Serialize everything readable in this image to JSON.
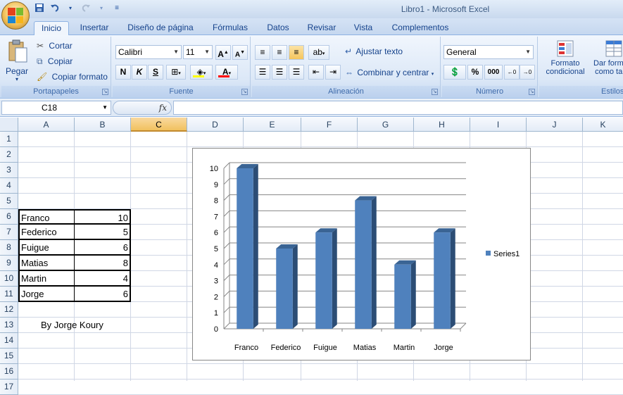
{
  "window": {
    "title": "Libro1  -  Microsoft Excel"
  },
  "quick_access": {
    "save_icon": "save-icon",
    "undo_icon": "undo-icon",
    "redo_icon": "redo-icon"
  },
  "tabs": [
    {
      "label": "Inicio",
      "active": true
    },
    {
      "label": "Insertar"
    },
    {
      "label": "Diseño de página"
    },
    {
      "label": "Fórmulas"
    },
    {
      "label": "Datos"
    },
    {
      "label": "Revisar"
    },
    {
      "label": "Vista"
    },
    {
      "label": "Complementos"
    }
  ],
  "ribbon": {
    "portapapeles": {
      "label": "Portapapeles",
      "paste": "Pegar",
      "cut": "Cortar",
      "copy": "Copiar",
      "format_painter": "Copiar formato"
    },
    "fuente": {
      "label": "Fuente",
      "font": "Calibri",
      "size": "11",
      "bold": "N",
      "italic": "K",
      "underline": "S",
      "fill_color": "#ffff00",
      "font_color": "#ff0000"
    },
    "alineacion": {
      "label": "Alineación",
      "wrap": "Ajustar texto",
      "merge": "Combinar y centrar"
    },
    "numero": {
      "label": "Número",
      "format": "General",
      "percent": "%",
      "thousands": "000"
    },
    "estilos": {
      "label": "Estilos",
      "conditional": "Formato condicional",
      "table": "Dar formato como tabla"
    }
  },
  "formula_bar": {
    "name_box": "C18",
    "fx": "fx",
    "formula": ""
  },
  "columns": [
    "A",
    "B",
    "C",
    "D",
    "E",
    "F",
    "G",
    "H",
    "I",
    "J",
    "K"
  ],
  "selected_column": "C",
  "rows": [
    "1",
    "2",
    "3",
    "4",
    "5",
    "6",
    "7",
    "8",
    "9",
    "10",
    "11",
    "12",
    "13",
    "14",
    "15",
    "16",
    "17"
  ],
  "cells": {
    "table": [
      {
        "name": "Franco",
        "value": "10"
      },
      {
        "name": "Federico",
        "value": "5"
      },
      {
        "name": "Fuigue",
        "value": "6"
      },
      {
        "name": "Matias",
        "value": "8"
      },
      {
        "name": "Martin",
        "value": "4"
      },
      {
        "name": "Jorge",
        "value": "6"
      }
    ],
    "credit": "By Jorge Koury"
  },
  "chart_data": {
    "type": "bar",
    "categories": [
      "Franco",
      "Federico",
      "Fuigue",
      "Matias",
      "Martin",
      "Jorge"
    ],
    "series": [
      {
        "name": "Series1",
        "values": [
          10,
          5,
          6,
          8,
          4,
          6
        ],
        "color": "#4f81bd"
      }
    ],
    "y_ticks": [
      "0",
      "1",
      "2",
      "3",
      "4",
      "5",
      "6",
      "7",
      "8",
      "9",
      "10"
    ],
    "ylim": [
      0,
      10
    ],
    "grid": true,
    "legend": "right",
    "style": "3d-column"
  }
}
